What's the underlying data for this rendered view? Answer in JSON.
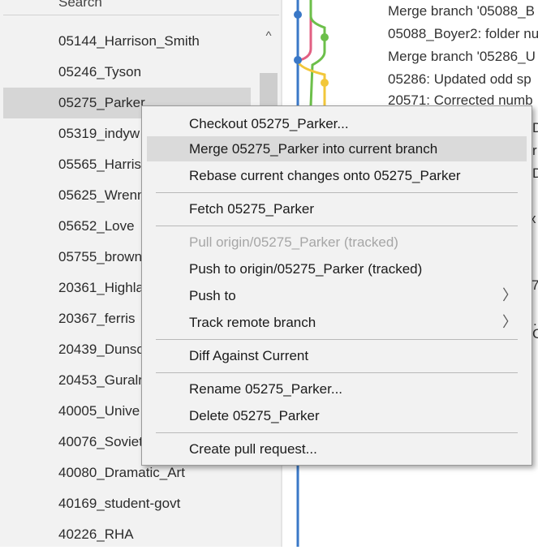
{
  "sidebar": {
    "search_label": "Search",
    "scroll_up_glyph": "^",
    "branches": [
      "05144_Harrison_Smith",
      "05246_Tyson",
      "05275_Parker",
      "05319_indyw",
      "05565_Harris",
      "05625_Wrenn",
      "05652_Love",
      "05755_brown",
      "20361_Highla",
      "20367_ferris",
      "20439_Dunso",
      "20453_Guralr",
      "40005_Unive",
      "40076_Soviet",
      "40080_Dramatic_Art",
      "40169_student-govt",
      "40226_RHA"
    ],
    "selected_index": 2
  },
  "commits": [
    "Merge branch '05088_B",
    "05088_Boyer2: folder nu",
    "Merge branch '05286_U",
    "05286: Updated odd sp",
    "20571: Corrected numb"
  ],
  "commit_edge_fragments": [
    "D",
    "r",
    "D",
    "x",
    "7",
    ".",
    "C"
  ],
  "graph_colors": {
    "blue": "#3a78c7",
    "pink": "#e25f82",
    "green": "#6cbf4a",
    "yellow": "#f2c73a"
  },
  "menu": {
    "checkout": "Checkout 05275_Parker...",
    "merge": "Merge 05275_Parker into current branch",
    "rebase": "Rebase current changes onto 05275_Parker",
    "fetch": "Fetch 05275_Parker",
    "pull": "Pull origin/05275_Parker (tracked)",
    "push_origin": "Push to origin/05275_Parker (tracked)",
    "push_to": "Push to",
    "track_remote": "Track remote branch",
    "diff": "Diff Against Current",
    "rename": "Rename 05275_Parker...",
    "delete": "Delete 05275_Parker",
    "pull_request": "Create pull request...",
    "submenu_glyph": "〉"
  }
}
